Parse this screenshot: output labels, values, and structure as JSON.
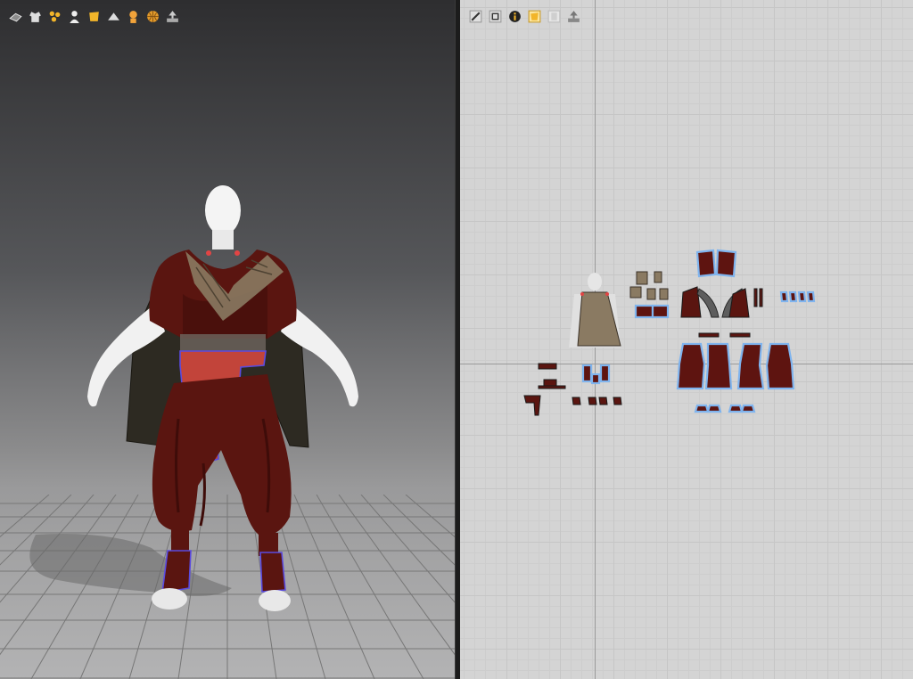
{
  "toolbar_3d": {
    "icons": [
      "simulation-icon",
      "garment-display-icon",
      "pin-icon",
      "avatar-display-icon",
      "texture-display-icon",
      "display-mode-icon",
      "skin-icon",
      "globe-icon",
      "export-icon"
    ]
  },
  "toolbar_2d": {
    "icons": [
      "edit-pattern-icon",
      "transform-pattern-icon",
      "info-icon",
      "texture-icon",
      "pattern-display-icon",
      "export-icon"
    ]
  },
  "colors": {
    "garment_dark_red": "#5a1510",
    "garment_red": "#a73a34",
    "sash_red": "#c2443a",
    "cape_dark": "#2d2a22",
    "trim_tan": "#8a7a62",
    "selection_blue": "#7fb4ee",
    "seam_purple": "#5a4be0",
    "pattern_grid": "#d4d4d4",
    "active_icon": "#f2b52a"
  }
}
